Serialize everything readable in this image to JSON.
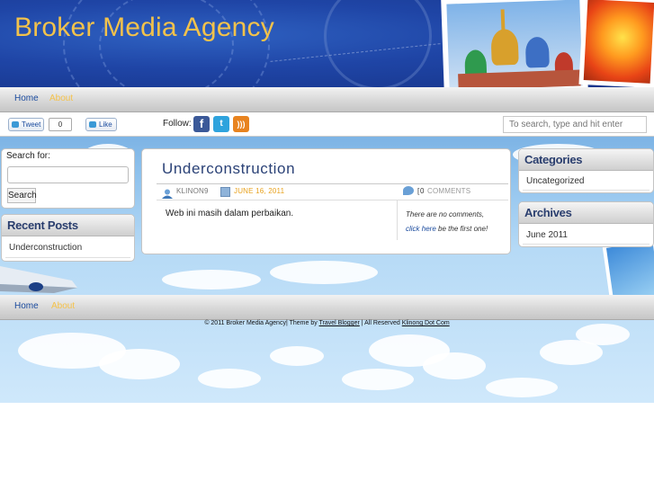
{
  "site": {
    "title": "Broker Media Agency"
  },
  "nav": {
    "home": "Home",
    "about": "About"
  },
  "social": {
    "tweet_label": "Tweet",
    "tweet_count": "0",
    "like_label": "Like",
    "follow_label": "Follow:",
    "search_placeholder": "To search, type and hit enter"
  },
  "sidebar_left": {
    "search_label": "Search for:",
    "search_value": "",
    "search_button": "Search",
    "recent_title": "Recent Posts",
    "recent_items": [
      "Underconstruction"
    ]
  },
  "post": {
    "title": "Underconstruction",
    "author": "KLINON9",
    "date": "JUNE 16, 2011",
    "comment_count": "0",
    "comments_label": "COMMENTS",
    "body": "Web ini masih dalam perbaikan.",
    "no_comments": "There are no comments,",
    "click_here": "click here",
    "first_one": " be the first one!"
  },
  "sidebar_right": {
    "categories_title": "Categories",
    "categories_items": [
      "Uncategorized"
    ],
    "archives_title": "Archives",
    "archives_items": [
      "June 2011"
    ]
  },
  "footer": {
    "prefix": "© 2011  Broker Media Agency| Theme by ",
    "theme_link": "Travel Blogger",
    "middle": " | All Reserved ",
    "credit_link": "Klinong Dot Com"
  },
  "colors": {
    "title_gold": "#f2c24b",
    "nav_link": "#1b4b9e",
    "widget_heading": "#2a3e6e",
    "date_orange": "#e8a21f"
  }
}
